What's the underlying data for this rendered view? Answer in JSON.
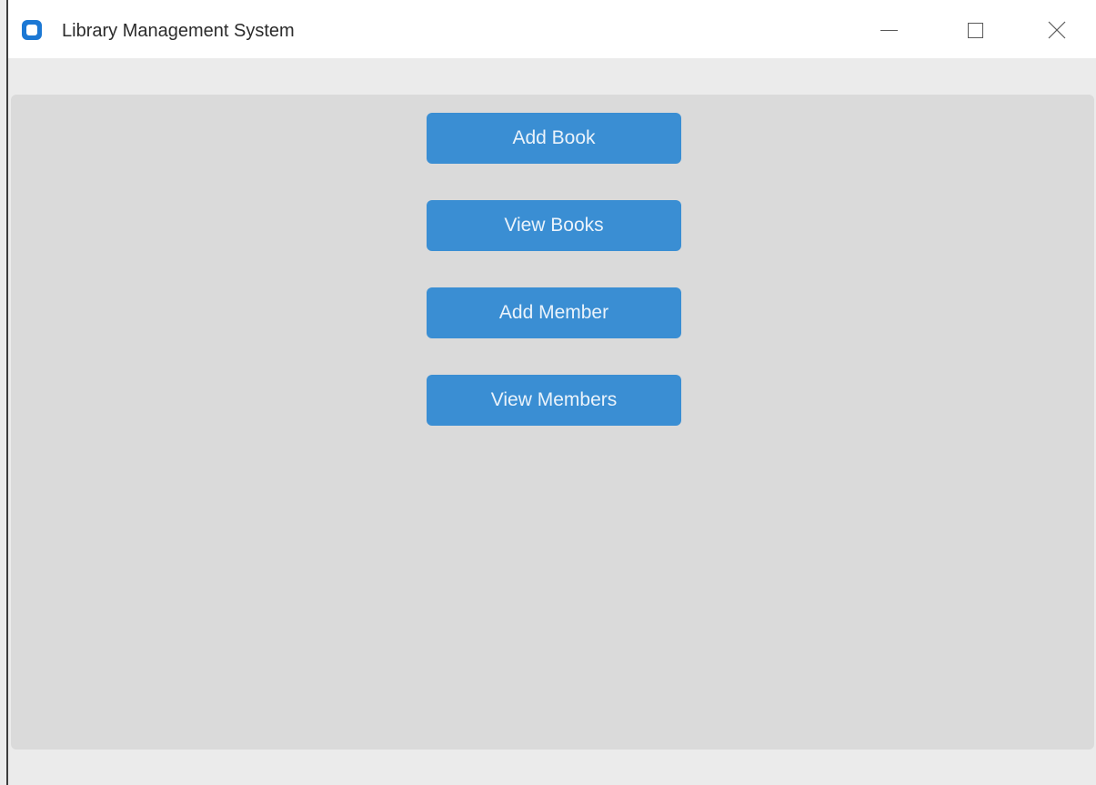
{
  "window": {
    "title": "Library Management System",
    "icon": "app-icon",
    "controls": {
      "minimize_icon": "minimize-icon",
      "maximize_icon": "maximize-icon",
      "close_icon": "close-icon"
    }
  },
  "main": {
    "buttons": [
      {
        "label": "Add Book"
      },
      {
        "label": "View Books"
      },
      {
        "label": "Add Member"
      },
      {
        "label": "View Members"
      }
    ]
  },
  "colors": {
    "accent": "#3a8ed3",
    "background": "#dadada",
    "frame": "#ebebeb"
  }
}
